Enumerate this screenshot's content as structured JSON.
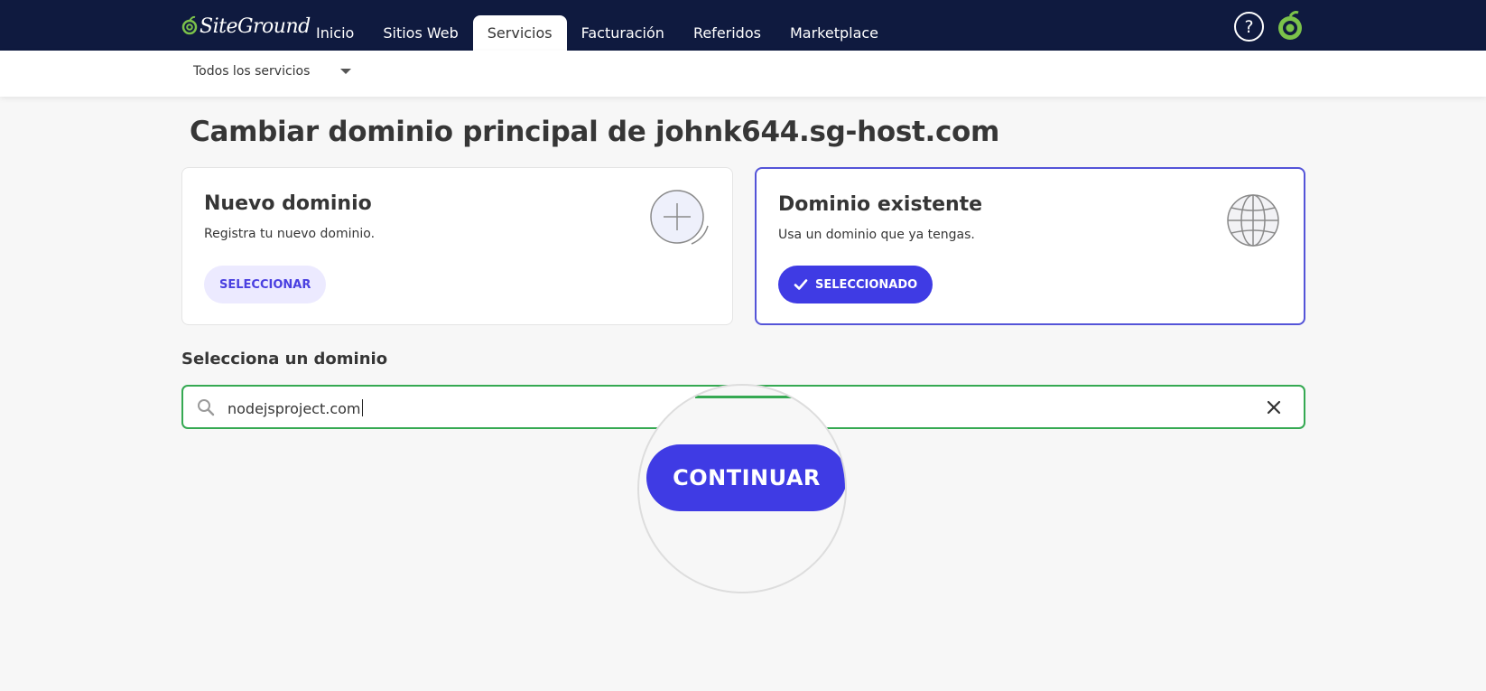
{
  "brand": {
    "logo_text": "SiteGround",
    "accent": "#3f3be4",
    "nav_bg": "#0f1a3f",
    "success": "#35a952"
  },
  "nav": {
    "items": [
      {
        "label": "Inicio",
        "active": false
      },
      {
        "label": "Sitios Web",
        "active": false
      },
      {
        "label": "Servicios",
        "active": true
      },
      {
        "label": "Facturación",
        "active": false
      },
      {
        "label": "Referidos",
        "active": false
      },
      {
        "label": "Marketplace",
        "active": false
      }
    ],
    "help_icon": "question-circle-icon",
    "avatar_icon": "siteground-swirl-avatar-icon"
  },
  "subbar": {
    "services_filter": "Todos los servicios"
  },
  "page": {
    "title": "Cambiar dominio principal de johnk644.sg-host.com"
  },
  "cards": {
    "new_domain": {
      "title": "Nuevo dominio",
      "description": "Registra tu nuevo dominio.",
      "button": "SELECCIONAR",
      "icon": "plus-circle-icon"
    },
    "existing_domain": {
      "title": "Dominio existente",
      "description": "Usa un dominio que ya tengas.",
      "button": "SELECCIONADO",
      "icon": "globe-icon",
      "selected": true
    }
  },
  "domain_select": {
    "label": "Selecciona un dominio",
    "value": "nodejsproject.com"
  },
  "actions": {
    "continue": "CONTINUAR"
  }
}
